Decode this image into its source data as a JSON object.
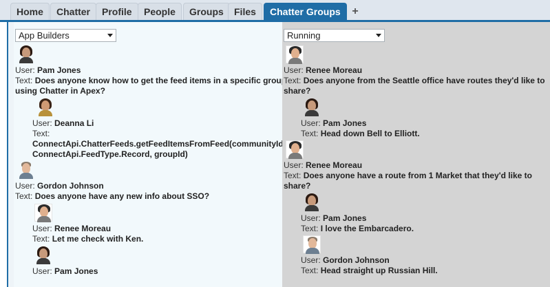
{
  "tabs": [
    "Home",
    "Chatter",
    "Profile",
    "People",
    "Groups",
    "Files",
    "Chatter Groups"
  ],
  "tab_add": "+",
  "left": {
    "select_value": "App Builders",
    "posts": [
      {
        "user": "Pam Jones",
        "text": "Does anyone know how to get the feed items in a specific group using Chatter in Apex?",
        "comments": [
          {
            "user": "Deanna Li",
            "text": "ConnectApi.ChatterFeeds.getFeedItemsFromFeed(communityId, ConnectApi.FeedType.Record, groupId)"
          }
        ]
      },
      {
        "user": "Gordon Johnson",
        "text": "Does anyone have any new info about SSO?",
        "comments": [
          {
            "user": "Renee Moreau",
            "text": "Let me check with Ken."
          },
          {
            "user": "Pam Jones",
            "text": ""
          }
        ]
      }
    ]
  },
  "right": {
    "select_value": "Running",
    "posts": [
      {
        "user": "Renee Moreau",
        "text": "Does anyone from the Seattle office have routes they'd like to share?",
        "comments": [
          {
            "user": "Pam Jones",
            "text": "Head down Bell to Elliott."
          }
        ]
      },
      {
        "user": "Renee Moreau",
        "text": "Does anyone have a route from 1 Market that they'd like to share?",
        "comments": [
          {
            "user": "Pam Jones",
            "text": "I love the Embarcadero."
          },
          {
            "user": "Gordon Johnson",
            "text": "Head straight up Russian Hill."
          }
        ]
      }
    ]
  },
  "labels": {
    "user": "User:",
    "text": "Text:"
  }
}
